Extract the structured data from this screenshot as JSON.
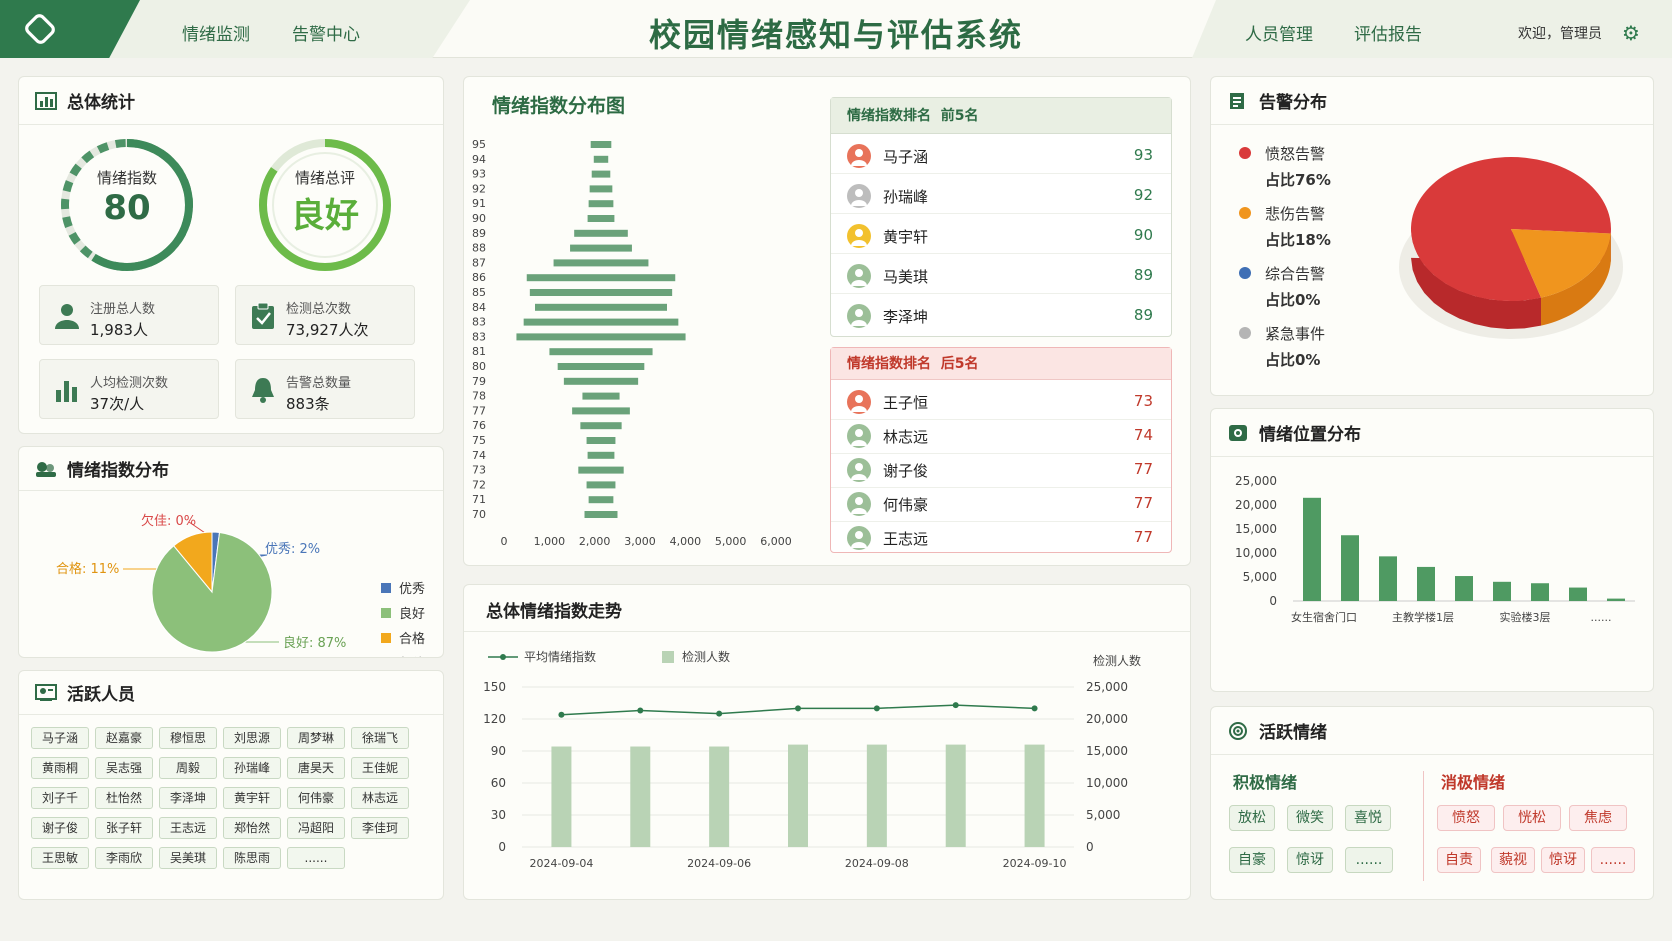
{
  "header": {
    "title": "校园情绪感知与评估系统",
    "nav_left": [
      "情绪监测",
      "告警中心"
    ],
    "nav_right": [
      "人员管理",
      "评估报告"
    ],
    "welcome": "欢迎，管理员"
  },
  "overall": {
    "title": "总体统计",
    "index_label": "情绪指数",
    "index_value": "80",
    "eval_label": "情绪总评",
    "eval_value": "良好",
    "stats": [
      {
        "label": "注册总人数",
        "value": "1,983人"
      },
      {
        "label": "检测总次数",
        "value": "73,927人次"
      },
      {
        "label": "人均检测次数",
        "value": "37次/人"
      },
      {
        "label": "告警总数量",
        "value": "883条"
      }
    ]
  },
  "dist_pie": {
    "title": "情绪指数分布",
    "labels": [
      "欠佳: 0%",
      "优秀: 2%",
      "合格: 11%",
      "良好: 87%"
    ],
    "legend": [
      "优秀",
      "良好",
      "合格",
      "欠佳"
    ],
    "values": [
      2,
      87,
      11,
      0
    ],
    "colors": [
      "#4a76b8",
      "#8cc07a",
      "#f2a81d",
      "#d94848"
    ]
  },
  "active_people": {
    "title": "活跃人员",
    "names": [
      "马子涵",
      "赵嘉豪",
      "穆恒思",
      "刘思源",
      "周梦琳",
      "徐瑞飞",
      "黄雨桐",
      "吴志强",
      "周毅",
      "孙瑞峰",
      "唐昊天",
      "王佳妮",
      "刘子千",
      "杜怡然",
      "李泽坤",
      "黄宇轩",
      "何伟豪",
      "林志远",
      "谢子俊",
      "张子轩",
      "王志远",
      "郑怡然",
      "冯超阳",
      "李佳珂",
      "王思敏",
      "李雨欣",
      "吴美琪",
      "陈思雨",
      "......"
    ]
  },
  "index_chart": {
    "title": "情绪指数分布图",
    "x_ticks": [
      "0",
      "1,000",
      "2,000",
      "3,000",
      "4,000",
      "5,000",
      "6,000"
    ],
    "y_ticks": [
      "95",
      "94",
      "93",
      "92",
      "91",
      "90",
      "89",
      "88",
      "87",
      "86",
      "85",
      "84",
      "83",
      "83",
      "81",
      "80",
      "79",
      "78",
      "77",
      "76",
      "75",
      "74",
      "73",
      "72",
      "71",
      "70"
    ],
    "chart_data": {
      "type": "bar",
      "orientation": "horizontal",
      "categories": [
        "95",
        "94",
        "93",
        "92",
        "91",
        "90",
        "89",
        "88",
        "87",
        "86",
        "85",
        "84",
        "83",
        "83",
        "81",
        "80",
        "79",
        "78",
        "77",
        "76",
        "75",
        "74",
        "73",
        "72",
        "71",
        "70"
      ],
      "values": [
        500,
        350,
        450,
        550,
        600,
        650,
        1300,
        1500,
        2300,
        3600,
        3450,
        3200,
        3750,
        4100,
        2500,
        2100,
        1800,
        900,
        1400,
        1000,
        700,
        650,
        1100,
        700,
        600,
        800
      ],
      "xlim": [
        0,
        6000
      ]
    }
  },
  "top5": {
    "title": "情绪指数排名  前5名",
    "rows": [
      {
        "name": "马子涵",
        "score": "93"
      },
      {
        "name": "孙瑞峰",
        "score": "92"
      },
      {
        "name": "黄宇轩",
        "score": "90"
      },
      {
        "name": "马美琪",
        "score": "89"
      },
      {
        "name": "李泽坤",
        "score": "89"
      }
    ],
    "avatar_colors": [
      "#e8735a",
      "#bdbdbd",
      "#f2c12e",
      "#9cbf98",
      "#9cbf98"
    ]
  },
  "bottom5": {
    "title": "情绪指数排名  后5名",
    "rows": [
      {
        "name": "王子恒",
        "score": "73"
      },
      {
        "name": "林志远",
        "score": "74"
      },
      {
        "name": "谢子俊",
        "score": "77"
      },
      {
        "name": "何伟豪",
        "score": "77"
      },
      {
        "name": "王志远",
        "score": "77"
      }
    ],
    "avatar_colors": [
      "#e8735a",
      "#9cbf98",
      "#9cbf98",
      "#9cbf98",
      "#9cbf98"
    ]
  },
  "trend": {
    "title": "总体情绪指数走势",
    "legend_line": "平均情绪指数",
    "legend_bar": "检测人数",
    "right_axis_title": "检测人数",
    "left_ticks": [
      "150",
      "120",
      "90",
      "60",
      "30",
      "0"
    ],
    "right_ticks": [
      "25,000",
      "20,000",
      "15,000",
      "10,000",
      "5,000",
      "0"
    ],
    "x_labels": [
      "2024-09-04",
      "2024-09-06",
      "2024-09-08",
      "2024-09-10"
    ],
    "chart_data": {
      "type": "bar+line",
      "x": [
        "2024-09-04",
        "2024-09-05",
        "2024-09-06",
        "2024-09-07",
        "2024-09-08",
        "2024-09-09",
        "2024-09-10"
      ],
      "series": [
        {
          "name": "平均情绪指数",
          "type": "line",
          "values": [
            124,
            128,
            125,
            130,
            130,
            133,
            130
          ],
          "ylim": [
            0,
            150
          ]
        },
        {
          "name": "检测人数",
          "type": "bar",
          "values": [
            15700,
            15700,
            15700,
            16000,
            16000,
            16000,
            16000
          ],
          "ylim": [
            0,
            25000
          ]
        }
      ]
    }
  },
  "alerts": {
    "title": "告警分布",
    "items": [
      {
        "name": "愤怒告警",
        "pct": "占比76%",
        "color": "#d93a3a"
      },
      {
        "name": "悲伤告警",
        "pct": "占比18%",
        "color": "#f0951e"
      },
      {
        "name": "综合告警",
        "pct": "占比0%",
        "color": "#3f6fb5"
      },
      {
        "name": "紧急事件",
        "pct": "占比0%",
        "color": "#b5b5b5"
      }
    ],
    "chart_data": {
      "type": "pie",
      "values": [
        76,
        18,
        0,
        0
      ]
    }
  },
  "location": {
    "title": "情绪位置分布",
    "y_ticks": [
      "25,000",
      "20,000",
      "15,000",
      "10,000",
      "5,000",
      "0"
    ],
    "x_labels": [
      "女生宿舍门口",
      "主教学楼1层",
      "实验楼3层",
      "......"
    ],
    "chart_data": {
      "type": "bar",
      "values": [
        21500,
        13700,
        9300,
        7100,
        5200,
        4000,
        3700,
        2800,
        500
      ],
      "ylim": [
        0,
        25000
      ]
    }
  },
  "active_emotion": {
    "title": "活跃情绪",
    "positive_title": "积极情绪",
    "negative_title": "消极情绪",
    "positive": [
      "放松",
      "微笑",
      "喜悦",
      "自豪",
      "惊讶",
      "......"
    ],
    "negative": [
      "愤怒",
      "恍松",
      "焦虑",
      "自责",
      "藐视",
      "惊讶",
      "......"
    ]
  }
}
